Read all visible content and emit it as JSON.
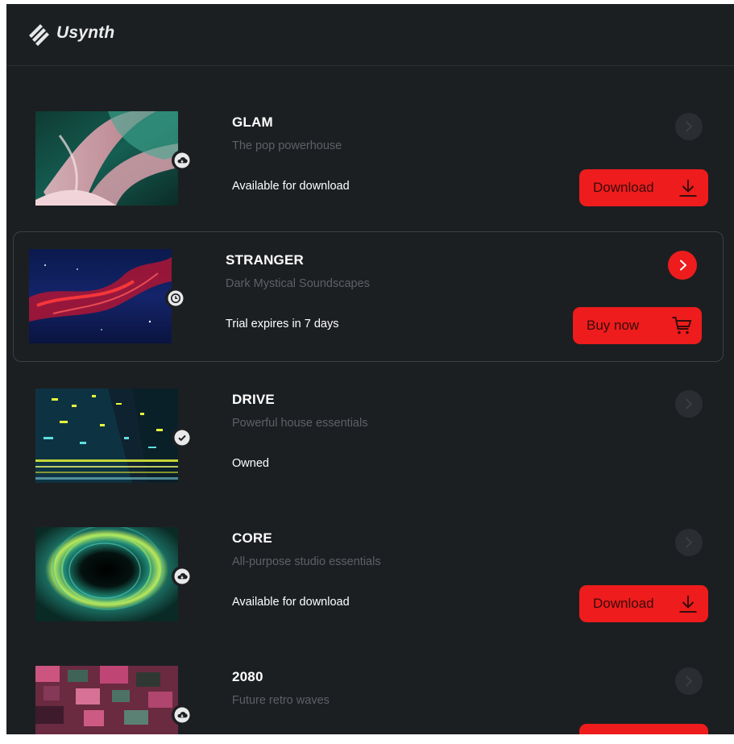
{
  "app": {
    "brand": "Usynth"
  },
  "products": [
    {
      "title": "GLAM",
      "subtitle": "The pop powerhouse",
      "status": "Available for download",
      "status_icon": "cloud-download-icon",
      "action": "Download",
      "action_icon": "download-icon",
      "selected": false
    },
    {
      "title": "STRANGER",
      "subtitle": "Dark Mystical Soundscapes",
      "status": "Trial expires in 7 days",
      "status_icon": "clock-icon",
      "action": "Buy now",
      "action_icon": "cart-icon",
      "selected": true
    },
    {
      "title": "DRIVE",
      "subtitle": "Powerful house essentials",
      "status": "Owned",
      "status_icon": "check-icon",
      "action": "",
      "selected": false
    },
    {
      "title": "CORE",
      "subtitle": "All-purpose studio essentials",
      "status": "Available for download",
      "status_icon": "cloud-download-icon",
      "action": "Download",
      "action_icon": "download-icon",
      "selected": false
    },
    {
      "title": "2080",
      "subtitle": "Future retro waves",
      "status": "",
      "status_icon": "cloud-download-icon",
      "action": "",
      "selected": false
    }
  ],
  "colors": {
    "background": "#1c1f22",
    "accent": "#ee1c1c",
    "text": "#ffffff",
    "muted": "#5d6167"
  }
}
